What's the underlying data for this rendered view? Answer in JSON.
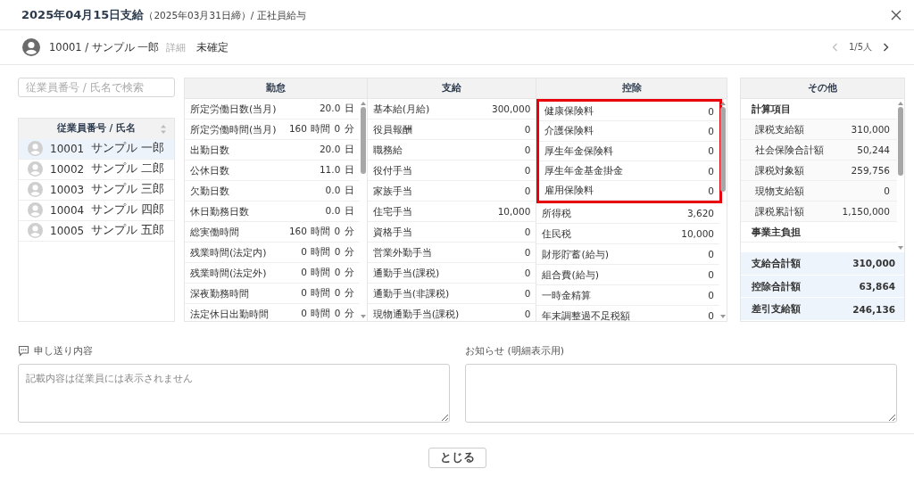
{
  "window": {
    "title": "2025年04月15日支給",
    "subtitle": "（2025年03月31日締）/ 正社員給与"
  },
  "employee_bar": {
    "name": "10001 / サンプル 一郎",
    "detail_link": "詳細",
    "status": "未確定",
    "pager": "1/5人"
  },
  "search": {
    "placeholder": "従業員番号 / 氏名で検索"
  },
  "employee_list": {
    "column": "従業員番号 / 氏名",
    "rows": [
      {
        "number": "10001",
        "name": "サンプル 一郎",
        "selected": true
      },
      {
        "number": "10002",
        "name": "サンプル 二郎",
        "selected": false
      },
      {
        "number": "10003",
        "name": "サンプル 三郎",
        "selected": false
      },
      {
        "number": "10004",
        "name": "サンプル 四郎",
        "selected": false
      },
      {
        "number": "10005",
        "name": "サンプル 五郎",
        "selected": false
      }
    ]
  },
  "sheet": {
    "columns": [
      {
        "title": "勤怠",
        "rows": [
          {
            "label": "所定労働日数(当月)",
            "value": "20.0 日",
            "highlighted": false
          },
          {
            "label": "所定労働時間(当月)",
            "value": "160 時間 0 分",
            "highlighted": false
          },
          {
            "label": "出勤日数",
            "value": "20.0 日",
            "highlighted": false
          },
          {
            "label": "公休日数",
            "value": "11.0 日",
            "highlighted": false
          },
          {
            "label": "欠勤日数",
            "value": "0.0 日",
            "highlighted": false
          },
          {
            "label": "休日勤務日数",
            "value": "0.0 日",
            "highlighted": false
          },
          {
            "label": "総実働時間",
            "value": "160 時間 0 分",
            "highlighted": false
          },
          {
            "label": "残業時間(法定内)",
            "value": "0 時間 0 分",
            "highlighted": false
          },
          {
            "label": "残業時間(法定外)",
            "value": "0 時間 0 分",
            "highlighted": false
          },
          {
            "label": "深夜勤務時間",
            "value": "0 時間 0 分",
            "highlighted": false
          },
          {
            "label": "法定休日出勤時間",
            "value": "0 時間 0 分",
            "highlighted": false
          }
        ]
      },
      {
        "title": "支給",
        "rows": [
          {
            "label": "基本給(月給)",
            "value": "300,000",
            "highlighted": false
          },
          {
            "label": "役員報酬",
            "value": "0",
            "highlighted": false
          },
          {
            "label": "職務給",
            "value": "0",
            "highlighted": false
          },
          {
            "label": "役付手当",
            "value": "0",
            "highlighted": false
          },
          {
            "label": "家族手当",
            "value": "0",
            "highlighted": false
          },
          {
            "label": "住宅手当",
            "value": "10,000",
            "highlighted": false
          },
          {
            "label": "資格手当",
            "value": "0",
            "highlighted": false
          },
          {
            "label": "営業外勤手当",
            "value": "0",
            "highlighted": false
          },
          {
            "label": "通勤手当(課税)",
            "value": "0",
            "highlighted": false
          },
          {
            "label": "通勤手当(非課税)",
            "value": "0",
            "highlighted": false
          },
          {
            "label": "現物通勤手当(課税)",
            "value": "0",
            "highlighted": false
          }
        ]
      },
      {
        "title": "控除",
        "rows": [
          {
            "label": "健康保険料",
            "value": "0",
            "highlighted": true
          },
          {
            "label": "介護保険料",
            "value": "0",
            "highlighted": true
          },
          {
            "label": "厚生年金保険料",
            "value": "0",
            "highlighted": true
          },
          {
            "label": "厚生年金基金掛金",
            "value": "0",
            "highlighted": true
          },
          {
            "label": "雇用保険料",
            "value": "0",
            "highlighted": true
          },
          {
            "label": "所得税",
            "value": "3,620",
            "highlighted": false
          },
          {
            "label": "住民税",
            "value": "10,000",
            "highlighted": false
          },
          {
            "label": "財形貯蓄(給与)",
            "value": "0",
            "highlighted": false
          },
          {
            "label": "組合費(給与)",
            "value": "0",
            "highlighted": false
          },
          {
            "label": "一時金精算",
            "value": "0",
            "highlighted": false
          },
          {
            "label": "年末調整過不足税額",
            "value": "0",
            "highlighted": false
          }
        ]
      }
    ]
  },
  "other": {
    "title": "その他",
    "rows": [
      {
        "kind": "section",
        "label": "計算項目"
      },
      {
        "kind": "item",
        "label": "課税支給額",
        "value": "310,000"
      },
      {
        "kind": "item",
        "label": "社会保険合計額",
        "value": "50,244"
      },
      {
        "kind": "item",
        "label": "課税対象額",
        "value": "259,756"
      },
      {
        "kind": "item",
        "label": "現物支給額",
        "value": "0"
      },
      {
        "kind": "item",
        "label": "課税累計額",
        "value": "1,150,000"
      },
      {
        "kind": "section",
        "label": "事業主負担"
      }
    ],
    "totals": [
      {
        "label": "支給合計額",
        "value": "310,000"
      },
      {
        "label": "控除合計額",
        "value": "63,864"
      },
      {
        "label": "差引支給額",
        "value": "246,136"
      }
    ]
  },
  "memo": {
    "label": "申し送り内容",
    "placeholder": "記載内容は従業員には表示されません"
  },
  "notice": {
    "label": "お知らせ (明細表示用)"
  },
  "buttons": [
    "とじる"
  ]
}
